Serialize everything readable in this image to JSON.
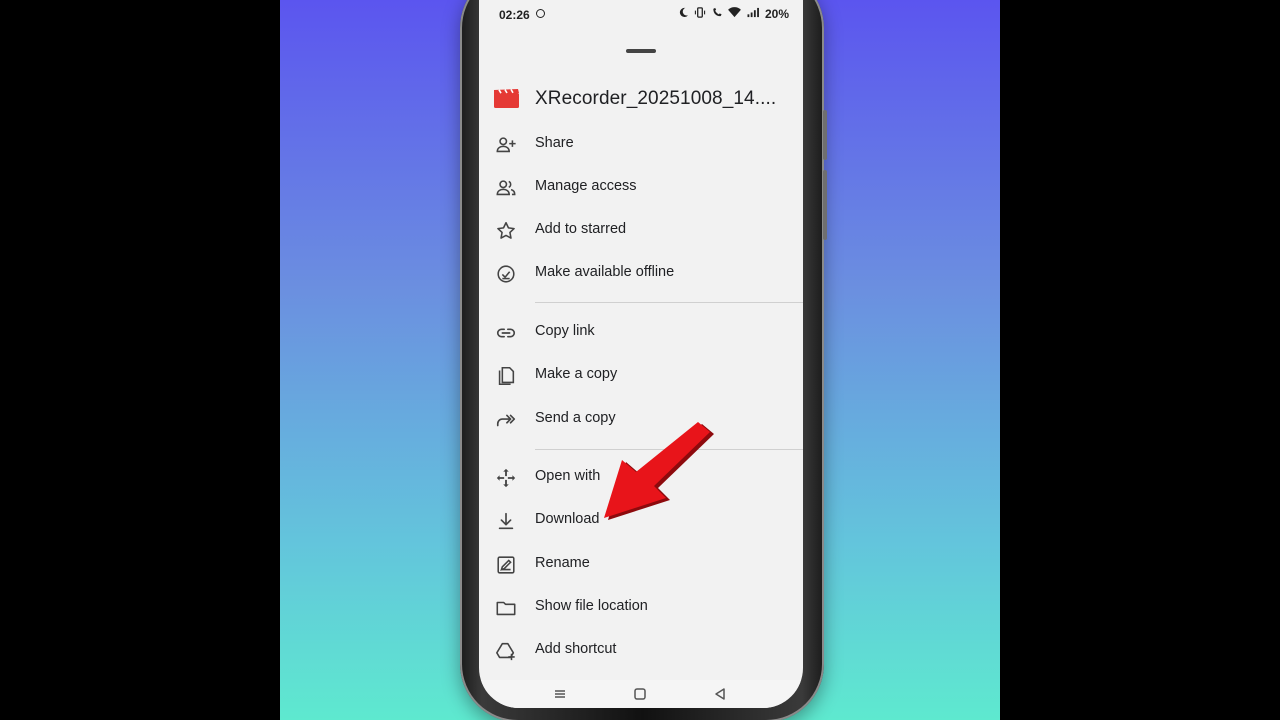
{
  "status_bar": {
    "time": "02:26",
    "battery": "20%",
    "icons": [
      "screen-record-icon",
      "moon-icon",
      "vibrate-icon",
      "wifi-call-icon",
      "wifi-icon",
      "signal-icon"
    ]
  },
  "file": {
    "name": "XRecorder_20251008_14....",
    "icon": "video-file-icon",
    "icon_color": "#e53935"
  },
  "menu": {
    "share": "Share",
    "manage_access": "Manage access",
    "add_to_starred": "Add to starred",
    "make_offline": "Make available offline",
    "copy_link": "Copy link",
    "make_copy": "Make a copy",
    "send_copy": "Send a copy",
    "open_with": "Open with",
    "download": "Download",
    "rename": "Rename",
    "show_location": "Show file location",
    "add_shortcut": "Add shortcut"
  },
  "nav": {
    "buttons": [
      "recents-icon",
      "home-icon",
      "back-icon"
    ]
  },
  "colors": {
    "background_top": "#5b55ef",
    "background_bottom": "#5ee9cf",
    "arrow": "#e8141a",
    "sheet": "#f2f2f2",
    "text": "#202124"
  }
}
